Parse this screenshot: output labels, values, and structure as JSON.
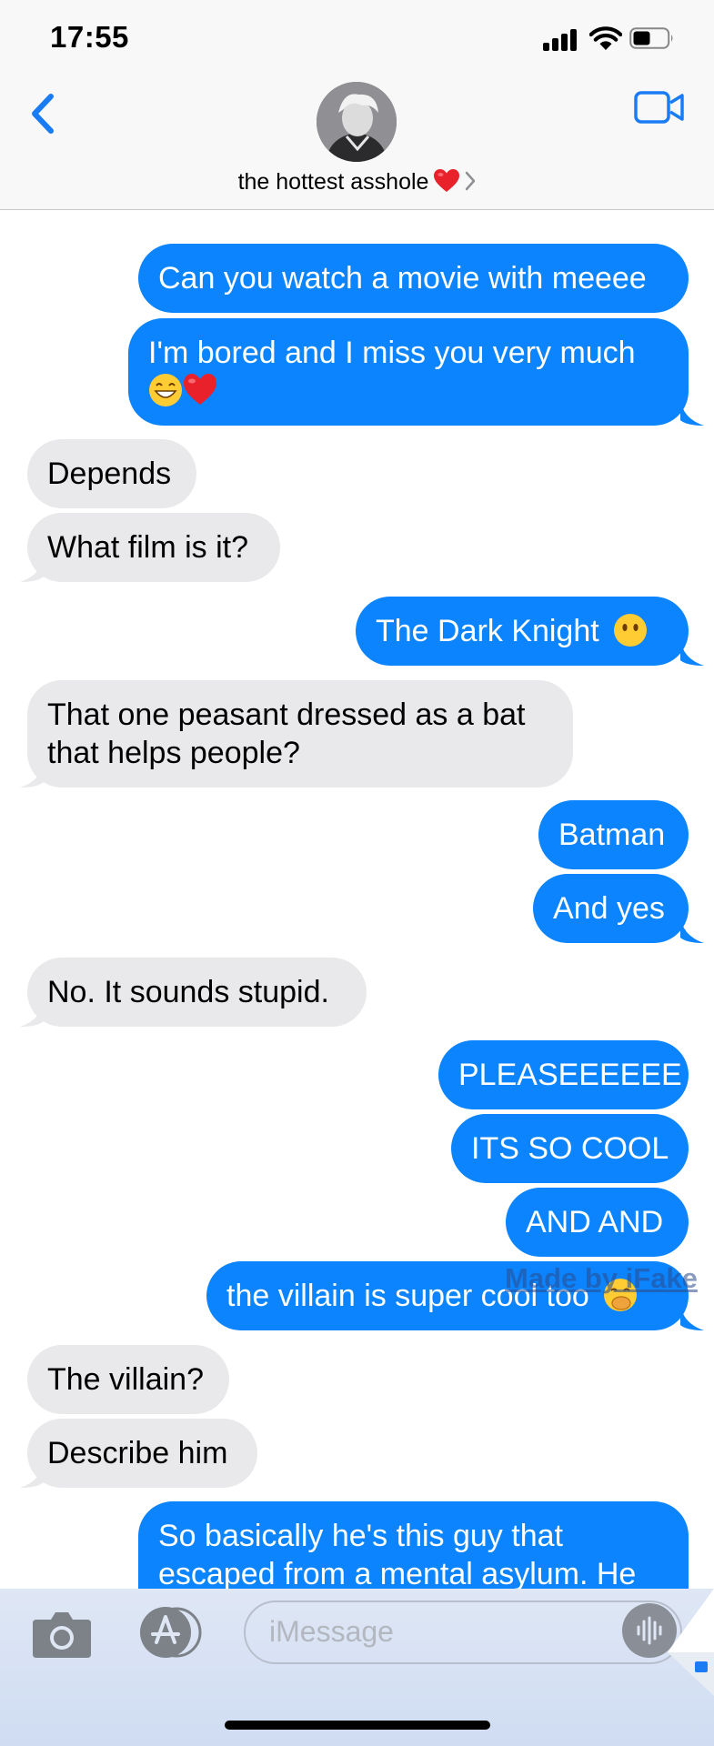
{
  "status_bar": {
    "time": "17:55"
  },
  "header": {
    "contact_name": "the hottest asshole",
    "name_emoji": "heart-emoji"
  },
  "messages": [
    {
      "side": "out",
      "text": "Can you watch a movie with meeee"
    },
    {
      "side": "out",
      "text": "I'm bored and I miss you very much",
      "emoji": [
        "grinning-emoji",
        "heart-emoji"
      ]
    },
    {
      "side": "in",
      "text": "Depends"
    },
    {
      "side": "in",
      "text": "What film is it?"
    },
    {
      "side": "out",
      "text": "The Dark Knight",
      "emoji": [
        "no-mouth-emoji"
      ]
    },
    {
      "side": "in",
      "text": "That one peasant dressed as a bat that helps people?"
    },
    {
      "side": "out",
      "text": "Batman"
    },
    {
      "side": "out",
      "text": "And yes"
    },
    {
      "side": "in",
      "text": "No. It sounds stupid."
    },
    {
      "side": "out",
      "text": "PLEASEEEEEE"
    },
    {
      "side": "out",
      "text": "ITS SO COOL"
    },
    {
      "side": "out",
      "text": "AND AND"
    },
    {
      "side": "out",
      "text": "the villain is super cool too",
      "emoji": [
        "hand-over-mouth-emoji"
      ]
    },
    {
      "side": "in",
      "text": "The villain?"
    },
    {
      "side": "in",
      "text": "Describe him"
    },
    {
      "side": "out",
      "text": "So basically he's this guy that escaped from a mental asylum. He"
    }
  ],
  "watermark": "Made by iFake",
  "composer": {
    "placeholder": "iMessage"
  },
  "colors": {
    "accent": "#0b84fe",
    "incoming_bubble": "#e9e9eb",
    "nav_blue": "#1a7cf5"
  }
}
